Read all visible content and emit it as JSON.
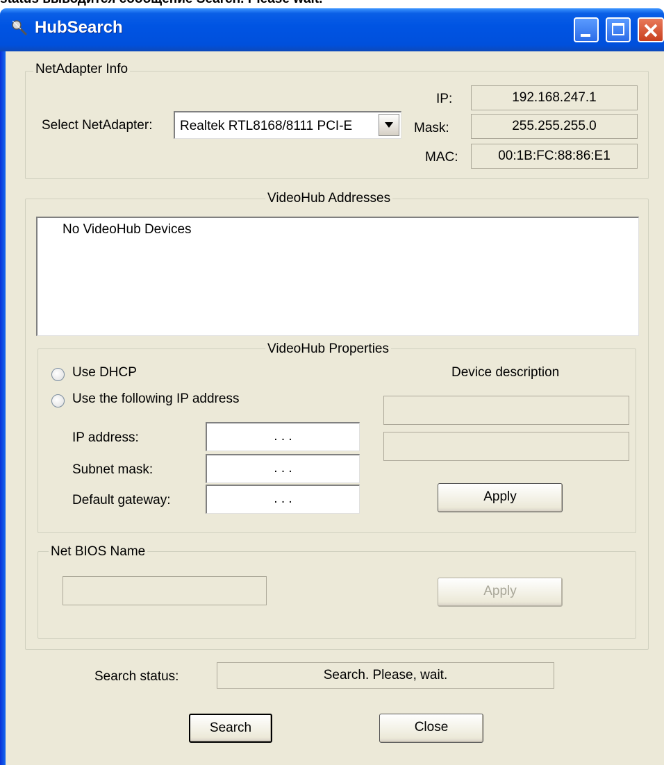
{
  "top_text": "status выводится сообщение Search. Please wait.",
  "window": {
    "title": "HubSearch"
  },
  "net_adapter": {
    "legend": "NetAdapter Info",
    "select_label": "Select NetAdapter:",
    "selected": "Realtek RTL8168/8111 PCI-E",
    "ip_label": "IP:",
    "ip_value": "192.168.247.1",
    "mask_label": "Mask:",
    "mask_value": "255.255.255.0",
    "mac_label": "MAC:",
    "mac_value": "00:1B:FC:88:86:E1"
  },
  "addresses": {
    "legend": "VideoHub Addresses",
    "items": [
      "No VideoHub Devices"
    ]
  },
  "properties": {
    "legend": "VideoHub Properties",
    "dhcp_label": "Use DHCP",
    "static_label": "Use the following IP address",
    "ip_label": "IP address:",
    "subnet_label": "Subnet mask:",
    "gateway_label": "Default gateway:",
    "ip_dots": ".      .      .",
    "device_desc_label": "Device description",
    "apply_label": "Apply"
  },
  "netbios": {
    "legend": "Net BIOS Name",
    "apply_label": "Apply"
  },
  "status": {
    "label": "Search status:",
    "value": "Search. Please, wait."
  },
  "buttons": {
    "search": "Search",
    "close": "Close"
  }
}
